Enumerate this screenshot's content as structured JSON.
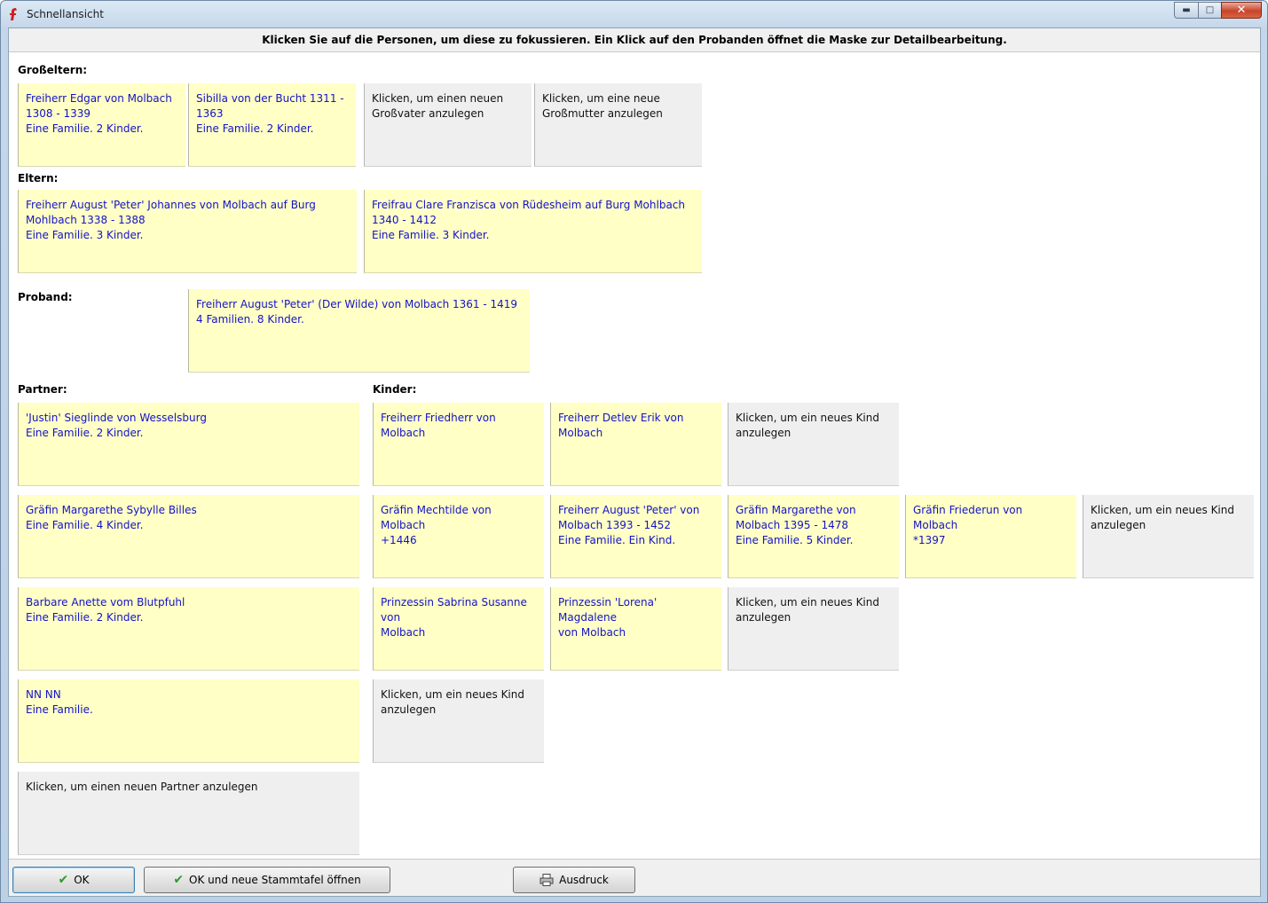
{
  "window": {
    "title": "Schnellansicht"
  },
  "info": "Klicken Sie auf die Personen, um diese zu fokussieren. Ein Klick auf den Probanden öffnet die Maske zur Detailbearbeitung.",
  "sections": {
    "grandparents": "Großeltern:",
    "parents": "Eltern:",
    "proband": "Proband:",
    "partner": "Partner:",
    "children": "Kinder:"
  },
  "grandparents": [
    {
      "lines": [
        "Freiherr Edgar von Molbach",
        "1308 - 1339",
        "Eine Familie.  2 Kinder."
      ]
    },
    {
      "lines": [
        "Sibilla von der Bucht 1311 -",
        "1363",
        "Eine Familie.  2 Kinder."
      ]
    },
    {
      "lines": [
        "Klicken, um einen neuen",
        "Großvater anzulegen"
      ]
    },
    {
      "lines": [
        "Klicken, um eine neue",
        "Großmutter anzulegen"
      ]
    }
  ],
  "parents": [
    {
      "lines": [
        "Freiherr August 'Peter' Johannes von Molbach auf Burg",
        "Mohlbach 1338 - 1388",
        "Eine Familie.  3 Kinder."
      ]
    },
    {
      "lines": [
        "Freifrau Clare Franzisca von Rüdesheim auf Burg Mohlbach",
        "1340 - 1412",
        "Eine Familie.  3 Kinder."
      ]
    }
  ],
  "proband": {
    "lines": [
      "Freiherr August 'Peter' (Der Wilde) von Molbach 1361 - 1419",
      "4 Familien.  8 Kinder."
    ]
  },
  "partners": [
    {
      "lines": [
        "'Justin' Sieglinde von Wesselsburg",
        "Eine Familie.  2 Kinder."
      ]
    },
    {
      "lines": [
        "Gräfin Margarethe Sybylle Billes",
        "Eine Familie.  4 Kinder."
      ]
    },
    {
      "lines": [
        "Barbare Anette vom Blutpfuhl",
        "Eine Familie.  2 Kinder."
      ]
    },
    {
      "lines": [
        "NN NN",
        "Eine Familie."
      ]
    },
    {
      "lines": [
        "Klicken, um einen neuen Partner anzulegen"
      ]
    }
  ],
  "children_rows": [
    [
      {
        "lines": [
          "Freiherr Friedherr von Molbach"
        ]
      },
      {
        "lines": [
          "Freiherr Detlev Erik von",
          "Molbach"
        ]
      },
      {
        "lines": [
          "Klicken, um ein neues Kind",
          "anzulegen"
        ]
      }
    ],
    [
      {
        "lines": [
          "Gräfin Mechtilde von Molbach",
          "+1446"
        ]
      },
      {
        "lines": [
          "Freiherr August 'Peter' von",
          "Molbach 1393 - 1452",
          "Eine Familie. Ein Kind."
        ]
      },
      {
        "lines": [
          "Gräfin Margarethe von",
          "Molbach 1395 - 1478",
          "Eine Familie.  5 Kinder."
        ]
      },
      {
        "lines": [
          "Gräfin Friederun von Molbach",
          "*1397"
        ]
      },
      {
        "lines": [
          "Klicken, um ein neues Kind",
          "anzulegen"
        ]
      }
    ],
    [
      {
        "lines": [
          "Prinzessin Sabrina Susanne von",
          "Molbach"
        ]
      },
      {
        "lines": [
          "Prinzessin 'Lorena' Magdalene",
          "von Molbach"
        ]
      },
      {
        "lines": [
          "Klicken, um ein neues Kind",
          "anzulegen"
        ]
      }
    ],
    [
      {
        "lines": [
          "Klicken, um ein neues Kind",
          "anzulegen"
        ]
      }
    ]
  ],
  "buttons": {
    "ok": "OK",
    "ok_new": "OK und neue Stammtafel öffnen",
    "print": "Ausdruck"
  },
  "colors": {
    "person_bg": "#ffffc6",
    "person_text": "#1313c8",
    "add_bg": "#efefef"
  }
}
